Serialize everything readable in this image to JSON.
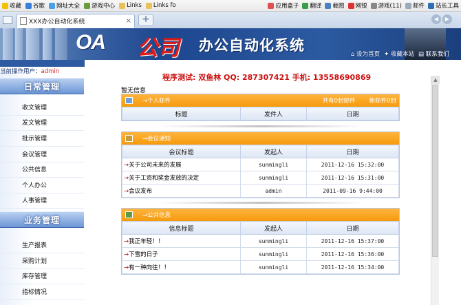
{
  "browser": {
    "bookmarks": [
      "收藏",
      "谷歌",
      "网址大全",
      "游戏中心",
      "Links",
      "Links fo"
    ],
    "bookmarks_right": [
      "应用盒子",
      "翻译",
      "截图",
      "网银",
      "游戏(11)",
      "邮件",
      "站长工具"
    ],
    "tab_title": "XXX办公自动化系统",
    "new_tab": "+",
    "close_tab": "×"
  },
  "header": {
    "logo_oa": "OA",
    "logo_company": "公司",
    "system_title": "办公自动化系统",
    "links": [
      "设为首页",
      "收藏本站",
      "联系我们"
    ]
  },
  "user_line": {
    "prefix": "当前操作用户：",
    "user": "admin"
  },
  "dev_info": "程序测试: 双鱼林    QQ: 287307421     手机: 13558690869",
  "sidebar": {
    "daily_title": "日常管理",
    "daily_items": [
      "收文管理",
      "发文管理",
      "批示管理",
      "会议管理",
      "公共信息",
      "个人办公",
      "人事管理"
    ],
    "business_title": "业务管理",
    "business_items": [
      "生产报表",
      "采购计划",
      "库存管理",
      "指标情况"
    ]
  },
  "main": {
    "no_message": "暂无信息",
    "mail_panel": {
      "title": "→个人邮件",
      "total": "共有0封邮件",
      "new_count": "新邮件0封",
      "columns": [
        "标题",
        "发件人",
        "日期"
      ]
    },
    "meeting_panel": {
      "title": "→会议通知",
      "columns": [
        "会议标题",
        "发起人",
        "日期"
      ],
      "rows": [
        {
          "title": "关于公司未来的发展",
          "sender": "sunmingli",
          "date": "2011-12-16 15:32:00"
        },
        {
          "title": "关于工资和奖金发放的决定",
          "sender": "sunmingli",
          "date": "2011-12-16 15:31:00"
        },
        {
          "title": "会议发布",
          "sender": "admin",
          "date": "2011-09-16 9:44:00"
        }
      ]
    },
    "public_panel": {
      "title": "→公共信息",
      "columns": [
        "信息标题",
        "发起人",
        "日期"
      ],
      "rows": [
        {
          "title": "我正年轻！！",
          "sender": "sunmingli",
          "date": "2011-12-16 15:37:00"
        },
        {
          "title": "下雪的日子",
          "sender": "sunmingli",
          "date": "2011-12-16 15:36:00"
        },
        {
          "title": "有一种向往！！",
          "sender": "sunmingli",
          "date": "2011-12-16 15:34:00"
        }
      ]
    },
    "row_arrow": "→"
  },
  "colors": {
    "accent_orange": "#f59a0c",
    "header_blue": "#1d468e",
    "dev_red": "#c11"
  }
}
